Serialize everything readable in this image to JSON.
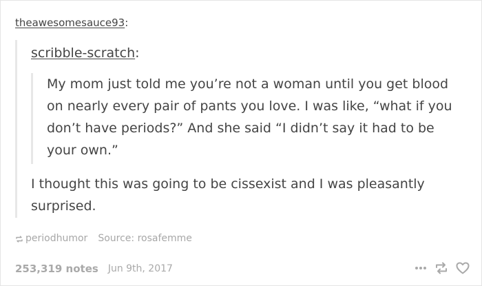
{
  "post": {
    "username": "theawesomesauce93",
    "username_suffix": ":",
    "quoted": {
      "username": "scribble-scratch",
      "username_suffix": ":",
      "original_text": "My mom just told me you’re not a woman until you get blood on nearly every pair of pants you love. I was like, “what if you don’t have periods?” And she said “I didn’t say it had to be your own.”",
      "reply_text": "I thought this was going to be cissexist and I was pleasantly surprised."
    },
    "tag": "periodhumor",
    "source": "Source: rosafemme",
    "notes": "253,319 notes",
    "date": "Jun 9th, 2017"
  },
  "icons": {
    "tag_icon": "reblog-icon",
    "more": "more-dots-icon",
    "reblog": "reblog-icon",
    "like": "heart-icon"
  },
  "colors": {
    "text": "#444444",
    "meta": "#a9a9a9",
    "quote_border": "#e7e7e7"
  }
}
